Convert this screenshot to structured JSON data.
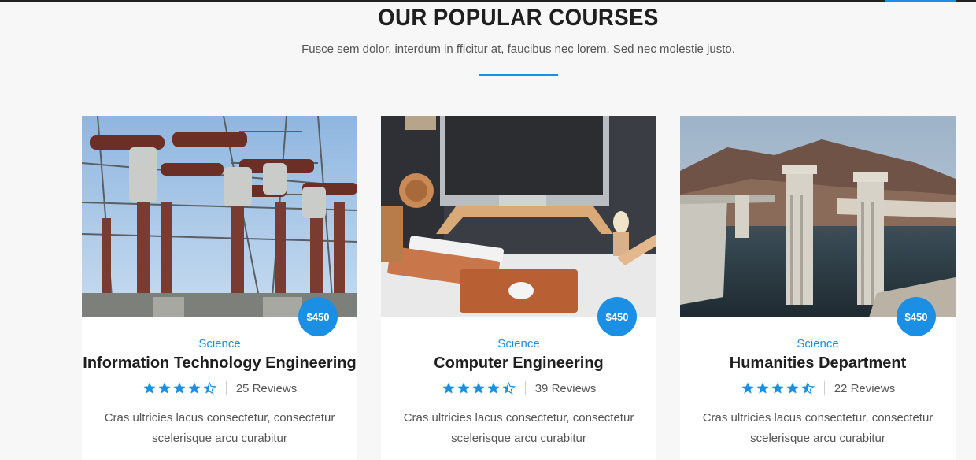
{
  "header": {
    "title": "OUR POPULAR COURSES",
    "subtitle": "Fusce sem dolor, interdum in fficitur at, faucibus nec lorem. Sed nec molestie justo."
  },
  "colors": {
    "accent": "#1a8fe3",
    "title": "#1f1f1f",
    "body_text": "#555555",
    "background": "#f7f7f7"
  },
  "courses": [
    {
      "image": "power-substation-photo",
      "price": "$450",
      "category": "Science",
      "title": "Information Technology Engineering",
      "rating": 4.5,
      "reviews": "25 Reviews",
      "description": "Cras ultricies lacus consectetur, consectetur scelerisque arcu curabitur"
    },
    {
      "image": "desk-computer-photo",
      "price": "$450",
      "category": "Science",
      "title": "Computer Engineering",
      "rating": 4.5,
      "reviews": "39 Reviews",
      "description": "Cras ultricies lacus consectetur, consectetur scelerisque arcu curabitur"
    },
    {
      "image": "dam-towers-photo",
      "price": "$450",
      "category": "Science",
      "title": "Humanities Department",
      "rating": 4.5,
      "reviews": "22 Reviews",
      "description": "Cras ultricies lacus consectetur, consectetur scelerisque arcu curabitur"
    }
  ]
}
